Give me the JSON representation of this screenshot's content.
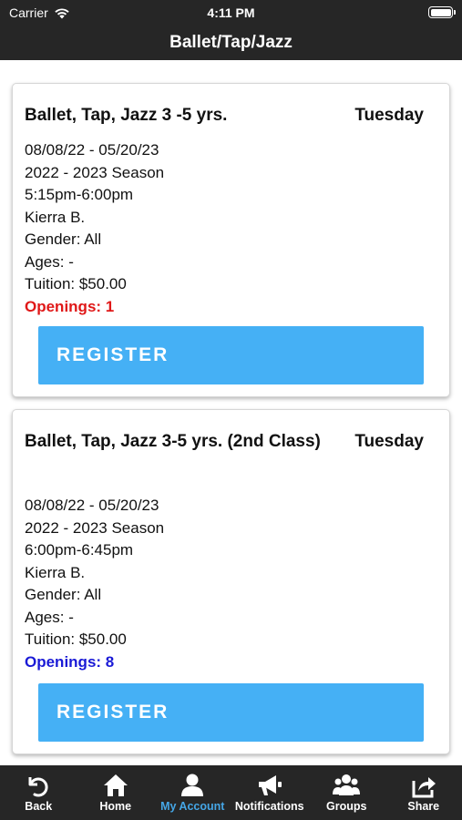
{
  "status_bar": {
    "carrier": "Carrier",
    "time": "4:11 PM",
    "wifi_icon": "wifi-icon",
    "battery_icon": "battery-icon"
  },
  "nav": {
    "title": "Ballet/Tap/Jazz"
  },
  "classes": [
    {
      "title": "Ballet, Tap, Jazz 3 -5 yrs.",
      "day": "Tuesday",
      "dates": "08/08/22 - 05/20/23",
      "season": "2022 - 2023 Season",
      "time": "5:15pm-6:00pm",
      "instructor": "Kierra B.",
      "gender": "Gender: All",
      "ages": "Ages: -",
      "tuition": "Tuition: $50.00",
      "openings": "Openings: 1",
      "openings_color": "#e01818",
      "register_label": "REGISTER"
    },
    {
      "title": "Ballet, Tap, Jazz 3-5 yrs. (2nd Class)",
      "day": "Tuesday",
      "dates": "08/08/22 - 05/20/23",
      "season": "2022 - 2023 Season",
      "time": "6:00pm-6:45pm",
      "instructor": "Kierra B.",
      "gender": "Gender: All",
      "ages": "Ages: -",
      "tuition": "Tuition: $50.00",
      "openings": "Openings: 8",
      "openings_color": "#1a1ad6",
      "register_label": "REGISTER"
    }
  ],
  "tabs": [
    {
      "label": "Back",
      "icon": "back-arrow-icon"
    },
    {
      "label": "Home",
      "icon": "home-icon"
    },
    {
      "label": "My Account",
      "icon": "person-icon",
      "active": true
    },
    {
      "label": "Notifications",
      "icon": "megaphone-icon"
    },
    {
      "label": "Groups",
      "icon": "groups-icon"
    },
    {
      "label": "Share",
      "icon": "share-icon"
    }
  ],
  "colors": {
    "bar_background": "#262626",
    "register_button": "#45b0f5",
    "active_tab": "#45a6e6"
  }
}
